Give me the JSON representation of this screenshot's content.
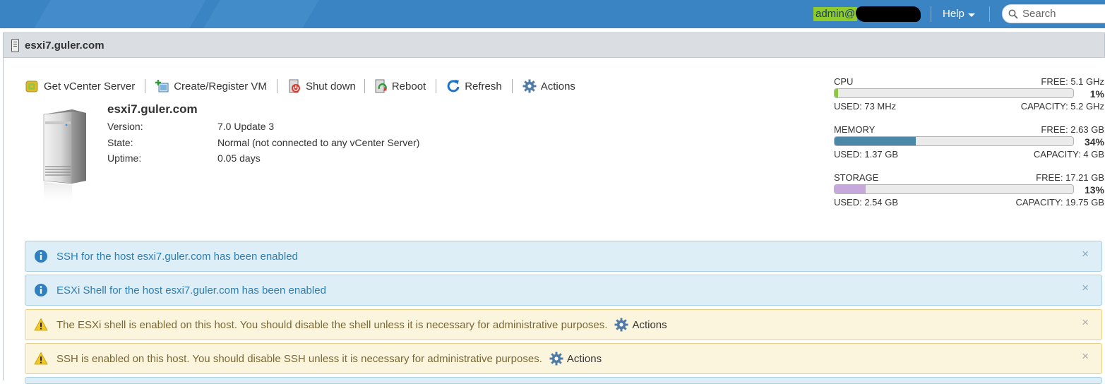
{
  "topbar": {
    "user_label": "admin@",
    "help_label": "Help",
    "search_placeholder": "Search",
    "user_highlight_color": "#8fcb2a",
    "bar_color": "#3a84c4"
  },
  "panel": {
    "title": "esxi7.guler.com",
    "icon": "host-icon"
  },
  "toolbar": {
    "items": [
      {
        "label": "Get vCenter Server",
        "icon": "vcenter-icon"
      },
      {
        "label": "Create/Register VM",
        "icon": "create-vm-icon"
      },
      {
        "label": "Shut down",
        "icon": "shutdown-icon"
      },
      {
        "label": "Reboot",
        "icon": "reboot-icon"
      },
      {
        "label": "Refresh",
        "icon": "refresh-icon"
      },
      {
        "label": "Actions",
        "icon": "gear-icon"
      }
    ]
  },
  "host": {
    "name": "esxi7.guler.com",
    "fields": [
      {
        "key": "Version:",
        "value": "7.0 Update 3"
      },
      {
        "key": "State:",
        "value": "Normal (not connected to any vCenter Server)"
      },
      {
        "key": "Uptime:",
        "value": "0.05 days"
      }
    ]
  },
  "resources": [
    {
      "name": "CPU",
      "free": "FREE: 5.1 GHz",
      "percent_label": "1%",
      "percent": 1,
      "used": "USED: 73 MHz",
      "capacity": "CAPACITY: 5.2 GHz",
      "color": "#8dc63f"
    },
    {
      "name": "MEMORY",
      "free": "FREE: 2.63 GB",
      "percent_label": "34%",
      "percent": 34,
      "used": "USED: 1.37 GB",
      "capacity": "CAPACITY: 4 GB",
      "color": "#4a87a8"
    },
    {
      "name": "STORAGE",
      "free": "FREE: 17.21 GB",
      "percent_label": "13%",
      "percent": 13,
      "used": "USED: 2.54 GB",
      "capacity": "CAPACITY: 19.75 GB",
      "color": "#c8a8dc"
    }
  ],
  "alerts": [
    {
      "type": "info",
      "text": "SSH for the host esxi7.guler.com has been enabled",
      "action": ""
    },
    {
      "type": "info",
      "text": "ESXi Shell for the host esxi7.guler.com has been enabled",
      "action": ""
    },
    {
      "type": "warning",
      "text": "The ESXi shell is enabled on this host. You should disable the shell unless it is necessary for administrative purposes.",
      "action": "Actions"
    },
    {
      "type": "warning",
      "text": "SSH is enabled on this host. You should disable SSH unless it is necessary for administrative purposes.",
      "action": "Actions"
    }
  ],
  "close_glyph": "×"
}
